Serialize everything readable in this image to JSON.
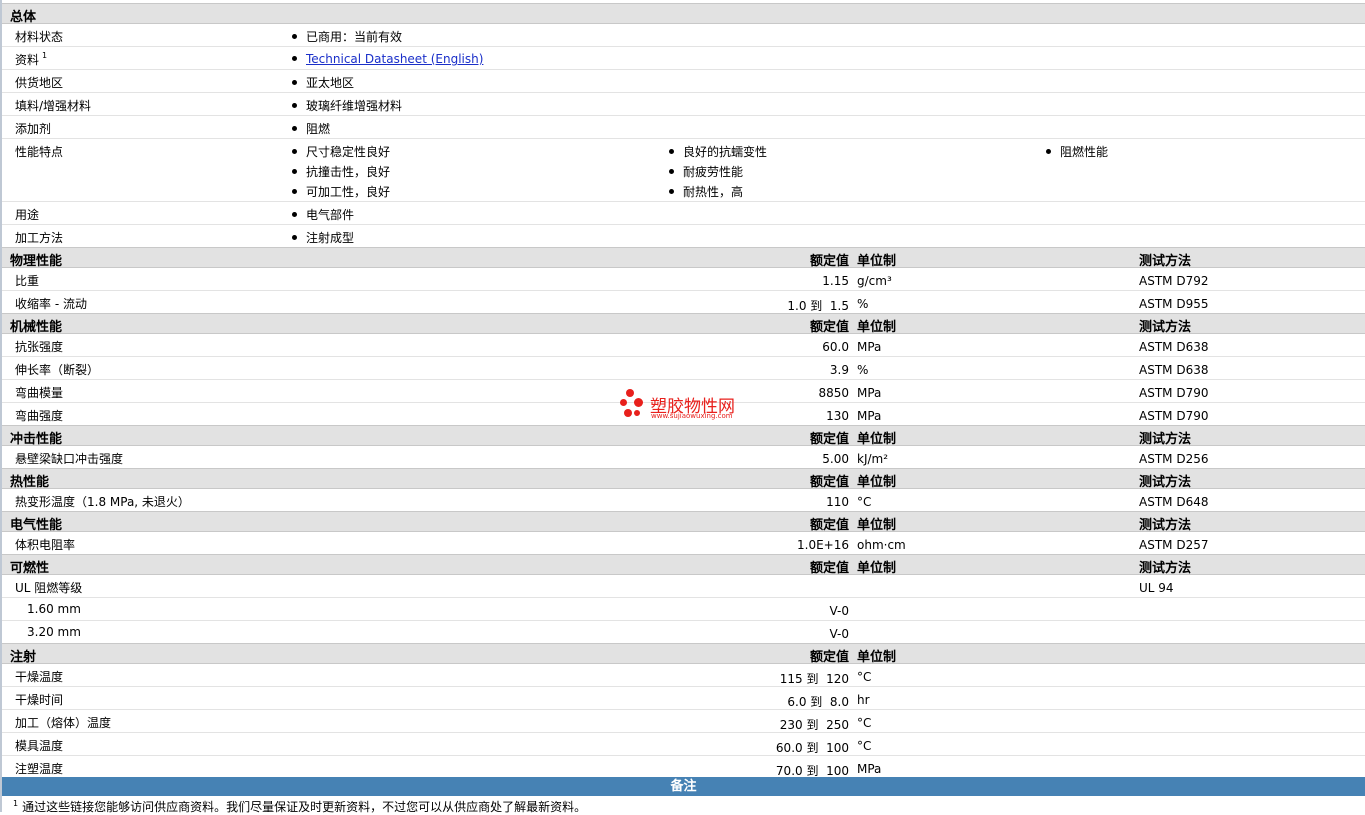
{
  "general": {
    "title": "总体",
    "rows": [
      {
        "label": "材料状态",
        "items": [
          "已商用：当前有效"
        ]
      },
      {
        "label": "资料",
        "sup": "1",
        "link": "Technical Datasheet (English)"
      },
      {
        "label": "供货地区",
        "items": [
          "亚太地区"
        ]
      },
      {
        "label": "填料/增强材料",
        "items": [
          "玻璃纤维增强材料"
        ]
      },
      {
        "label": "添加剂",
        "items": [
          "阻燃"
        ]
      },
      {
        "label": "性能特点",
        "items": [
          "尺寸稳定性良好",
          "良好的抗蠕变性",
          "阻燃性能",
          "抗撞击性，良好",
          "耐疲劳性能",
          "可加工性，良好",
          "耐热性，高"
        ]
      },
      {
        "label": "用途",
        "items": [
          "电气部件"
        ]
      },
      {
        "label": "加工方法",
        "items": [
          "注射成型"
        ]
      }
    ]
  },
  "headers": {
    "value": "额定值",
    "unit": "单位制",
    "method": "测试方法"
  },
  "sections": {
    "physical": {
      "title": "物理性能",
      "rows": [
        {
          "label": "比重",
          "value": "1.15",
          "unit": "g/cm³",
          "method": "ASTM D792"
        },
        {
          "label": "收缩率 - 流动",
          "value": "1.0 到  1.5",
          "unit": "%",
          "method": "ASTM D955"
        }
      ]
    },
    "mechanical": {
      "title": "机械性能",
      "rows": [
        {
          "label": "抗张强度",
          "value": "60.0",
          "unit": "MPa",
          "method": "ASTM D638"
        },
        {
          "label": "伸长率（断裂）",
          "value": "3.9",
          "unit": "%",
          "method": "ASTM D638"
        },
        {
          "label": "弯曲模量",
          "value": "8850",
          "unit": "MPa",
          "method": "ASTM D790"
        },
        {
          "label": "弯曲强度",
          "value": "130",
          "unit": "MPa",
          "method": "ASTM D790"
        }
      ]
    },
    "impact": {
      "title": "冲击性能",
      "rows": [
        {
          "label": "悬壁梁缺口冲击强度",
          "value": "5.00",
          "unit": "kJ/m²",
          "method": "ASTM D256"
        }
      ]
    },
    "thermal": {
      "title": "热性能",
      "rows": [
        {
          "label": "热变形温度（1.8 MPa, 未退火）",
          "value": "110",
          "unit": "°C",
          "method": "ASTM D648"
        }
      ]
    },
    "electrical": {
      "title": "电气性能",
      "rows": [
        {
          "label": "体积电阻率",
          "value": "1.0E+16",
          "unit": "ohm·cm",
          "method": "ASTM D257"
        }
      ]
    },
    "flammability": {
      "title": "可燃性",
      "rows": [
        {
          "label": "UL 阻燃等级",
          "value": "",
          "unit": "",
          "method": "UL 94"
        },
        {
          "label": "1.60 mm",
          "value": "V-0",
          "unit": "",
          "method": ""
        },
        {
          "label": "3.20 mm",
          "value": "V-0",
          "unit": "",
          "method": ""
        }
      ]
    },
    "injection": {
      "title": "注射",
      "rows": [
        {
          "label": "干燥温度",
          "value": "115 到  120",
          "unit": "°C",
          "method": ""
        },
        {
          "label": "干燥时间",
          "value": "6.0 到  8.0",
          "unit": "hr",
          "method": ""
        },
        {
          "label": "加工（熔体）温度",
          "value": "230 到  250",
          "unit": "°C",
          "method": ""
        },
        {
          "label": "模具温度",
          "value": "60.0 到  100",
          "unit": "°C",
          "method": ""
        },
        {
          "label": "注塑温度",
          "value": "70.0 到  100",
          "unit": "MPa",
          "method": ""
        }
      ]
    }
  },
  "notes": {
    "title": "备注",
    "footnote_mark": "1",
    "footnote": "通过这些链接您能够访问供应商资料。我们尽量保证及时更新资料，不过您可以从供应商处了解最新资料。"
  },
  "watermark": {
    "name": "塑胶物性网",
    "url": "www.sujiaowuxing.com",
    "color": "#e8201c"
  }
}
